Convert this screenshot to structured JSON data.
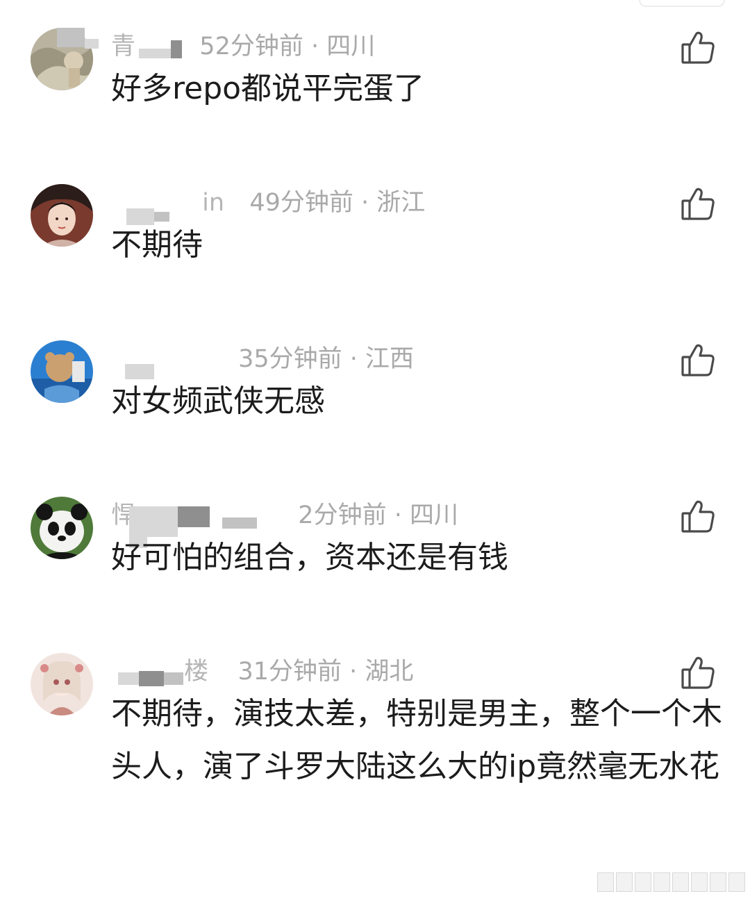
{
  "colors": {
    "text_primary": "#1c1c1c",
    "text_meta": "#a9a9a9",
    "like_icon": "#4a4a4a"
  },
  "comments": [
    {
      "name": "青",
      "meta": "52分钟前 · 四川",
      "text": "好多repo都说平完蛋了",
      "avatar": "landscape-avatar",
      "like_icon": "thumbs-up-icon"
    },
    {
      "name": "in",
      "meta": "49分钟前 · 浙江",
      "text": "不期待",
      "avatar": "portrait-avatar",
      "like_icon": "thumbs-up-icon"
    },
    {
      "name": "",
      "meta": "35分钟前 · 江西",
      "text": "对女频武侠无感",
      "avatar": "cartoon-avatar",
      "like_icon": "thumbs-up-icon"
    },
    {
      "name": "悍",
      "meta": "2分钟前 · 四川",
      "text": "好可怕的组合，资本还是有钱",
      "avatar": "panda-avatar",
      "like_icon": "thumbs-up-icon"
    },
    {
      "name": "楼",
      "meta": "31分钟前 · 湖北",
      "text": "不期待，演技太差，特别是男主，整个一个木头人，演了斗罗大陆这么大的ip竟然毫无水花",
      "avatar": "doll-avatar",
      "like_icon": "thumbs-up-icon"
    }
  ]
}
